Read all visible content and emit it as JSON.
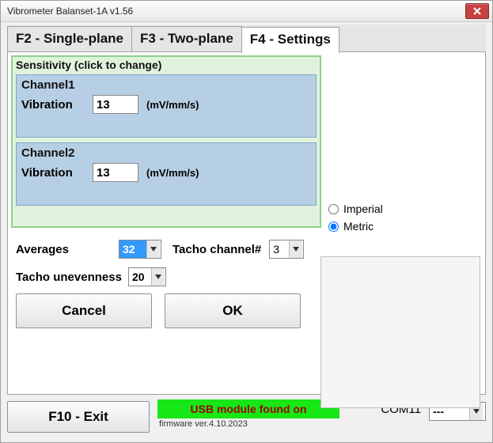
{
  "window": {
    "title": "Vibrometer Balanset-1A  v1.56"
  },
  "tabs": {
    "f2": "F2 - Single-plane",
    "f3": "F3 - Two-plane",
    "f4": "F4 - Settings"
  },
  "sensitivity": {
    "title": "Sensitivity (click to change)",
    "channel1": {
      "label": "Channel1",
      "vibration_label": "Vibration",
      "value": "13",
      "unit": "(mV/mm/s)"
    },
    "channel2": {
      "label": "Channel2",
      "vibration_label": "Vibration",
      "value": "13",
      "unit": "(mV/mm/s)"
    }
  },
  "settings": {
    "averages_label": "Averages",
    "averages_value": "32",
    "tacho_channel_label": "Tacho channel#",
    "tacho_channel_value": "3",
    "tacho_uneven_label": "Tacho unevenness",
    "tacho_uneven_value": "20"
  },
  "units": {
    "imperial": "Imperial",
    "metric": "Metric",
    "selected": "metric"
  },
  "buttons": {
    "cancel": "Cancel",
    "ok": "OK",
    "exit": "F10 - Exit"
  },
  "footer": {
    "usb_status": "USB module found on",
    "com_port": "COM11",
    "com_select": "---",
    "firmware": "firmware ver.4.10.2023"
  }
}
